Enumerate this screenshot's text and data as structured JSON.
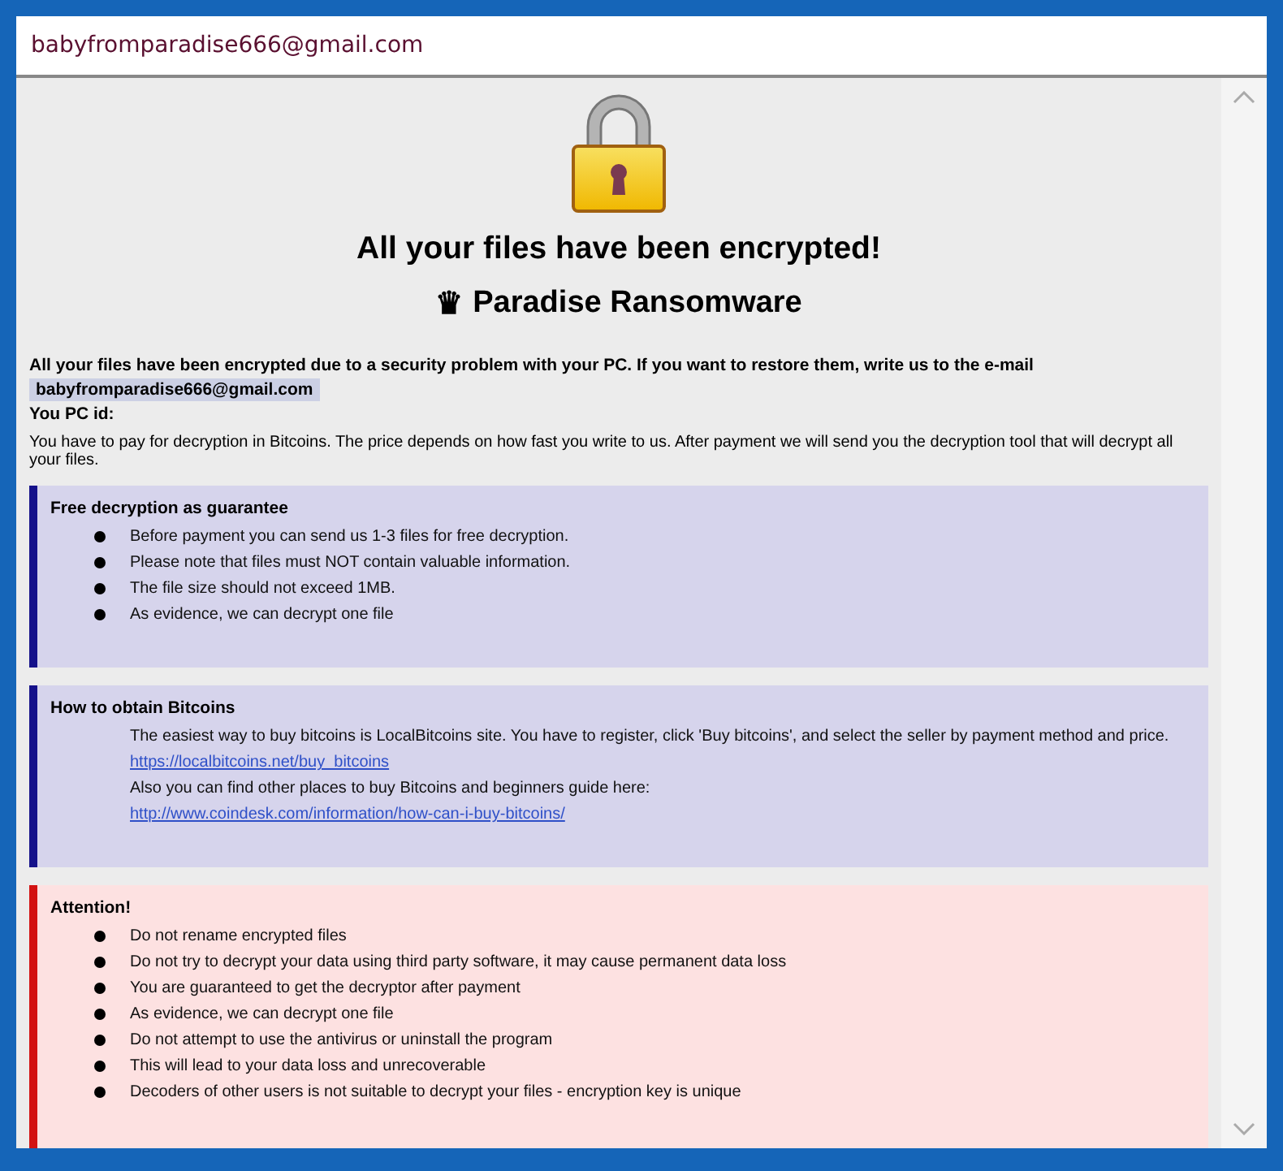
{
  "window": {
    "title": "babyfromparadise666@gmail.com"
  },
  "heading": "All your files have been encrypted!",
  "subheading_icon": "♛",
  "subheading": "Paradise Ransomware",
  "intro": "All your files have been encrypted due to a security problem with your PC. If you want to restore them, write us to the e-mail",
  "email": "babyfromparadise666@gmail.com",
  "pc_id_label": "You PC id:",
  "payment_note": "You have to pay for decryption in Bitcoins. The price depends on how fast you write to us. After payment we will send you the decryption tool that will decrypt all your files.",
  "sections": [
    {
      "kind": "info",
      "title": "Free decryption as guarantee",
      "lines": [
        {
          "kind": "bullet",
          "text": "Before payment you can send us 1-3 files for free decryption."
        },
        {
          "kind": "bullet",
          "text": "Please note that files must NOT contain valuable information."
        },
        {
          "kind": "bullet",
          "text": "The file size should not exceed 1MB."
        },
        {
          "kind": "bullet",
          "text": "As evidence, we can decrypt one file"
        }
      ]
    },
    {
      "kind": "info",
      "title": "How to obtain Bitcoins",
      "lines": [
        {
          "kind": "text",
          "text": "The easiest way to buy bitcoins is LocalBitcoins site. You have to register, click 'Buy bitcoins', and select the seller by payment method and price."
        },
        {
          "kind": "link",
          "text": "https://localbitcoins.net/buy_bitcoins"
        },
        {
          "kind": "text",
          "text": "Also you can find other places to buy Bitcoins and beginners guide here:"
        },
        {
          "kind": "link",
          "text": "http://www.coindesk.com/information/how-can-i-buy-bitcoins/"
        }
      ]
    },
    {
      "kind": "warning",
      "title": "Attention!",
      "lines": [
        {
          "kind": "bullet",
          "text": "Do not rename encrypted files"
        },
        {
          "kind": "bullet",
          "text": "Do not try to decrypt your data using third party software, it may cause permanent data loss"
        },
        {
          "kind": "bullet",
          "text": "You are guaranteed to get the decryptor after payment"
        },
        {
          "kind": "bullet",
          "text": "As evidence, we can decrypt one file"
        },
        {
          "kind": "bullet",
          "text": "Do not attempt to use the antivirus or uninstall the program"
        },
        {
          "kind": "bullet",
          "text": "This will lead to your data loss and unrecoverable"
        },
        {
          "kind": "bullet",
          "text": "Decoders of other users is not suitable to decrypt your files - encryption key is unique"
        }
      ]
    }
  ]
}
